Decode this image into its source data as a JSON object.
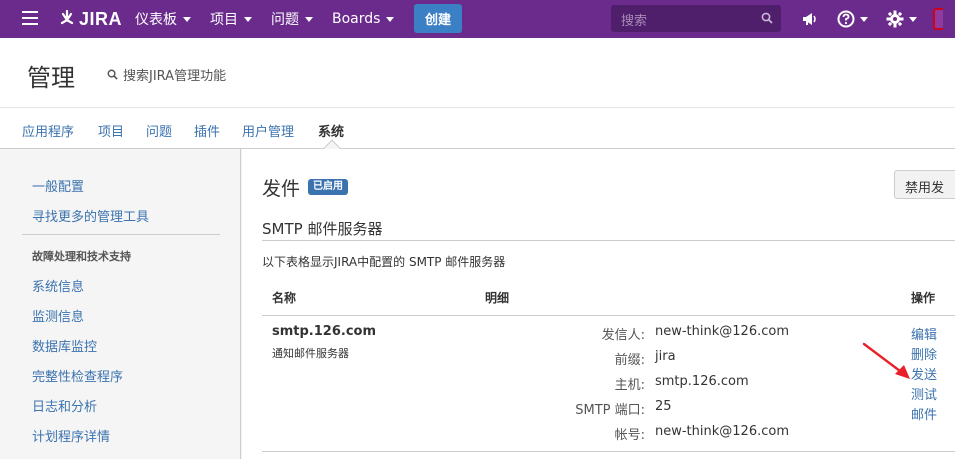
{
  "topnav": {
    "logo_text": "JIRA",
    "menus": [
      {
        "label": "仪表板"
      },
      {
        "label": "项目"
      },
      {
        "label": "问题"
      },
      {
        "label": "Boards"
      }
    ],
    "create_label": "创建",
    "search_placeholder": "搜索",
    "icons": [
      "menu-icon",
      "jira-logo-icon",
      "search-icon",
      "megaphone-icon",
      "help-icon",
      "gear-icon"
    ],
    "colors": {
      "bar": "#6a2b8c",
      "create": "#3b7fc4"
    }
  },
  "admin": {
    "title": "管理",
    "search_link": "搜索JIRA管理功能"
  },
  "tabs": [
    {
      "label": "应用程序",
      "active": false
    },
    {
      "label": "项目",
      "active": false
    },
    {
      "label": "问题",
      "active": false
    },
    {
      "label": "插件",
      "active": false
    },
    {
      "label": "用户管理",
      "active": false
    },
    {
      "label": "系统",
      "active": true
    }
  ],
  "sidebar": {
    "links_top": [
      "一般配置",
      "寻找更多的管理工具"
    ],
    "heading": "故障处理和技术支持",
    "links_bottom": [
      "系统信息",
      "监测信息",
      "数据库监控",
      "完整性检查程序",
      "日志和分析",
      "计划程序详情"
    ]
  },
  "content": {
    "page_title": "发件",
    "badge": "已启用",
    "disable_button": "禁用发",
    "section_title": "SMTP 邮件服务器",
    "description": "以下表格显示JIRA中配置的 SMTP 邮件服务器",
    "table": {
      "headers": {
        "name": "名称",
        "details": "明细",
        "actions": "操作"
      },
      "rows": [
        {
          "name": "smtp.126.com",
          "desc": "通知邮件服务器",
          "details": [
            {
              "label": "发信人:",
              "value": "new-think@126.com"
            },
            {
              "label": "前缀:",
              "value": "jira"
            },
            {
              "label": "主机:",
              "value": "smtp.126.com"
            },
            {
              "label": "SMTP 端口:",
              "value": "25"
            },
            {
              "label": "帐号:",
              "value": "new-think@126.com"
            }
          ],
          "actions": [
            "编辑",
            "删除",
            "发送",
            "测试",
            "邮件"
          ]
        }
      ]
    }
  },
  "colors": {
    "link": "#3b73af",
    "badge": "#3b73af",
    "annotation": "#e8202a"
  }
}
